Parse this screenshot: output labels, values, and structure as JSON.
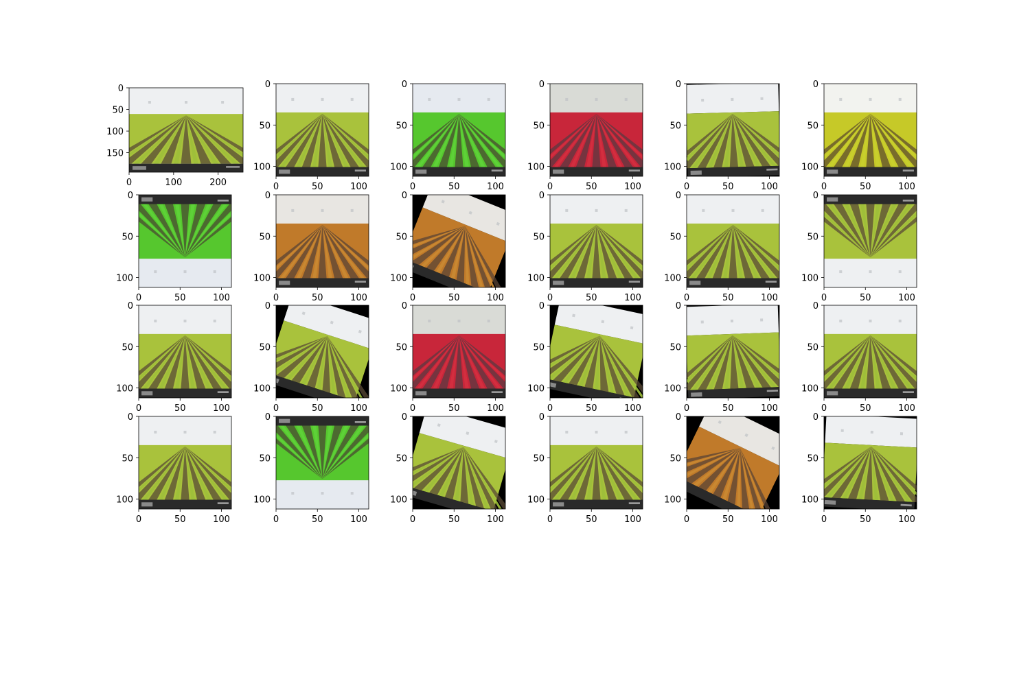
{
  "figure": {
    "rows": 4,
    "cols": 6,
    "panels": [
      {
        "variant": "original",
        "rotate": 0,
        "flip": false,
        "xlim": [
          0,
          256
        ],
        "ylim": [
          0,
          195
        ],
        "xticks": [
          "0",
          "100",
          "200"
        ],
        "yticks": [
          "0",
          "50",
          "100",
          "150"
        ],
        "xtick_values": [
          0,
          100,
          200
        ],
        "ytick_values": [
          0,
          50,
          100,
          150
        ]
      },
      {
        "variant": "plain",
        "rotate": 0,
        "flip": false
      },
      {
        "variant": "green",
        "rotate": 0,
        "flip": false
      },
      {
        "variant": "red",
        "rotate": 0,
        "flip": false
      },
      {
        "variant": "plain",
        "rotate": -1.5,
        "flip": false
      },
      {
        "variant": "yellow",
        "rotate": 0,
        "flip": false
      },
      {
        "variant": "green",
        "rotate": 0,
        "flip": true
      },
      {
        "variant": "orange",
        "rotate": 0,
        "flip": false
      },
      {
        "variant": "orange",
        "rotate": 22,
        "flip": false
      },
      {
        "variant": "plain",
        "rotate": 0,
        "flip": false
      },
      {
        "variant": "plain",
        "rotate": 0,
        "flip": false
      },
      {
        "variant": "plain",
        "rotate": 0,
        "flip": true
      },
      {
        "variant": "plain",
        "rotate": 0,
        "flip": false
      },
      {
        "variant": "plain",
        "rotate": 18,
        "flip": false
      },
      {
        "variant": "red",
        "rotate": 0,
        "flip": false
      },
      {
        "variant": "plain",
        "rotate": 12,
        "flip": false
      },
      {
        "variant": "plain",
        "rotate": -2,
        "flip": false
      },
      {
        "variant": "plain",
        "rotate": 0,
        "flip": false
      },
      {
        "variant": "plain",
        "rotate": 0,
        "flip": false
      },
      {
        "variant": "green",
        "rotate": 0,
        "flip": true
      },
      {
        "variant": "plain",
        "rotate": 16,
        "flip": false
      },
      {
        "variant": "plain",
        "rotate": 0,
        "flip": false
      },
      {
        "variant": "orange",
        "rotate": 26,
        "flip": false
      },
      {
        "variant": "plain",
        "rotate": 3,
        "flip": false
      }
    ],
    "default_axes": {
      "xlim": [
        0,
        112
      ],
      "ylim": [
        0,
        112
      ],
      "xticks": [
        "0",
        "50",
        "100"
      ],
      "yticks": [
        "0",
        "50",
        "100"
      ],
      "xtick_values": [
        0,
        50,
        100
      ],
      "ytick_values": [
        0,
        50,
        100
      ]
    },
    "palettes": {
      "plain": {
        "sky": "#eef0f2",
        "field": "#a9c23c",
        "soil": "#5a4a35",
        "plant": "#9dbf3a"
      },
      "green": {
        "sky": "#e6eaf0",
        "field": "#56c72e",
        "soil": "#4a4a32",
        "plant": "#5fd13a"
      },
      "red": {
        "sky": "#d9dbd6",
        "field": "#c8263a",
        "soil": "#5b3a42",
        "plant": "#d43040"
      },
      "yellow": {
        "sky": "#f2f3ef",
        "field": "#c6c928",
        "soil": "#5e4c2c",
        "plant": "#c8cf2e"
      },
      "orange": {
        "sky": "#e8e6e2",
        "field": "#c07a2a",
        "soil": "#5a4436",
        "plant": "#c98a33"
      }
    },
    "colors": {
      "footer": "#2a2a2a",
      "axis": "#000000",
      "background": "#ffffff",
      "rotation_fill": "#000000"
    }
  }
}
